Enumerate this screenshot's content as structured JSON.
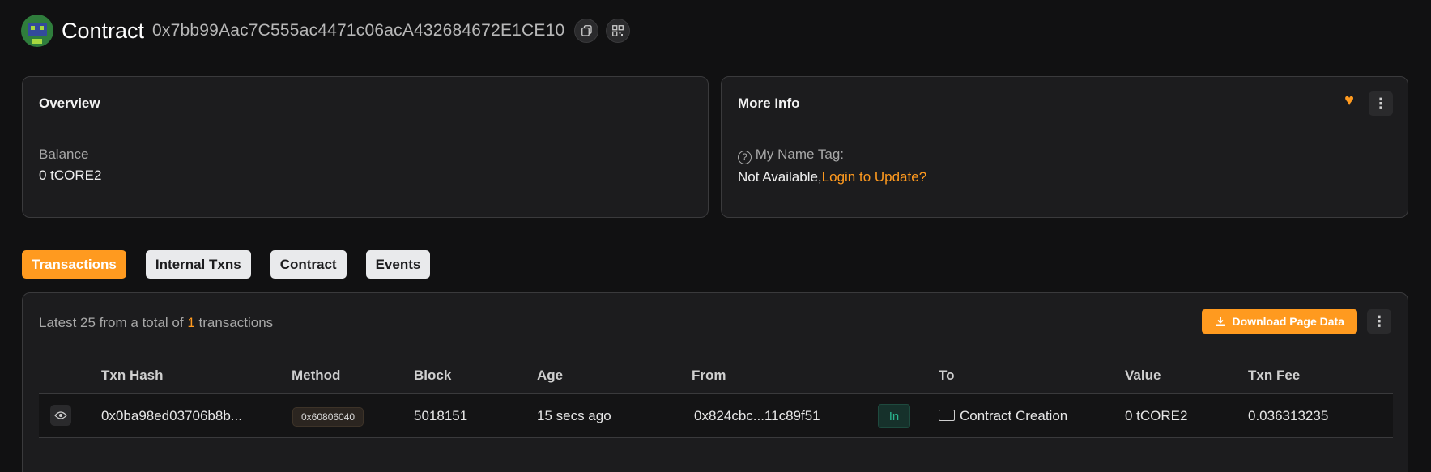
{
  "header": {
    "title": "Contract",
    "address": "0x7bb99Aac7C555ac4471c06acA432684672E1CE10",
    "copy_icon": "copy-icon",
    "qr_icon": "qr-code-icon"
  },
  "overview": {
    "title": "Overview",
    "balance_label": "Balance",
    "balance_value": "0 tCORE2"
  },
  "more_info": {
    "title": "More Info",
    "name_tag_icon": "?",
    "name_tag_label": "My Name Tag:",
    "not_available": "Not Available,",
    "login_link": "Login to Update?"
  },
  "tabs": [
    {
      "label": "Transactions",
      "active": true
    },
    {
      "label": "Internal Txns",
      "active": false
    },
    {
      "label": "Contract",
      "active": false
    },
    {
      "label": "Events",
      "active": false
    }
  ],
  "transactions": {
    "summary_prefix": "Latest 25 from a total of ",
    "summary_count": "1",
    "summary_suffix": " transactions",
    "download_label": "Download Page Data",
    "columns": [
      "Txn Hash",
      "Method",
      "Block",
      "Age",
      "From",
      "To",
      "Value",
      "Txn Fee"
    ],
    "rows": [
      {
        "hash": "0x0ba98ed03706b8b...",
        "method": "0x60806040",
        "block": "5018151",
        "age": "15 secs ago",
        "from": "0x824cbc...11c89f51",
        "direction": "In",
        "to": "Contract Creation",
        "value": "0 tCORE2",
        "fee": "0.036313235"
      }
    ]
  },
  "colors": {
    "accent": "#ff9a1f",
    "background": "#111112",
    "card": "#1c1c1e",
    "in_badge": "#29b58f"
  }
}
